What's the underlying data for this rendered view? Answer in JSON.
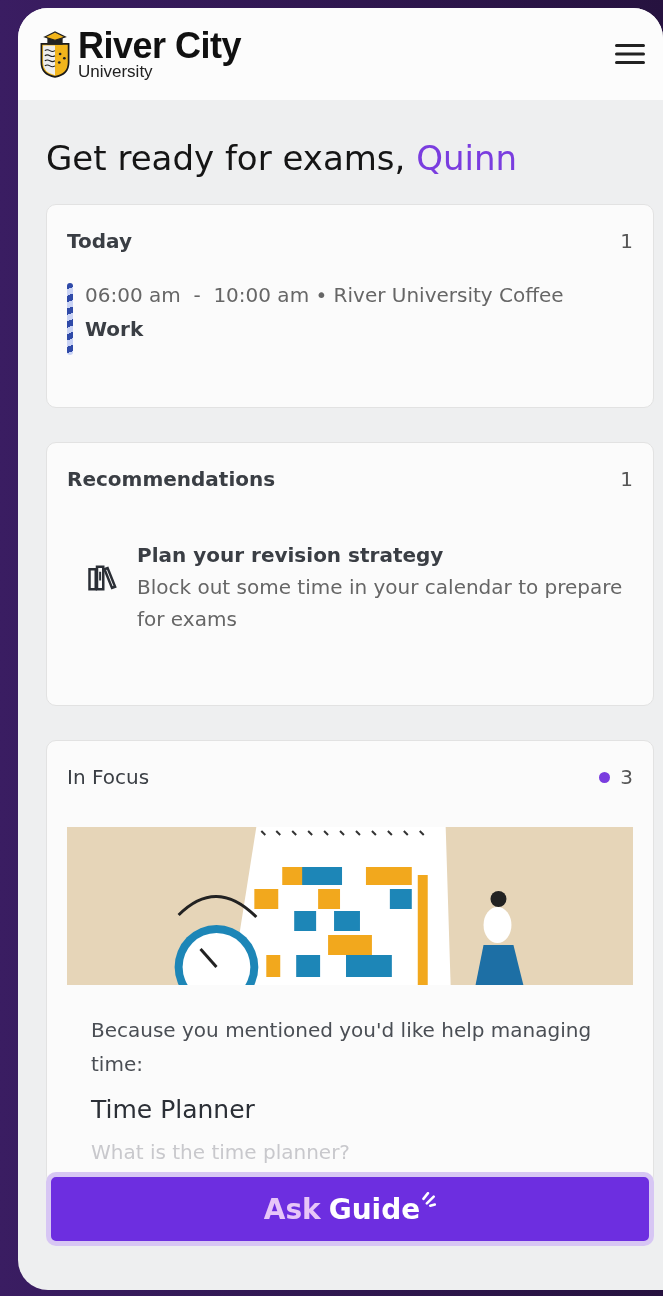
{
  "header": {
    "logo_title": "River City",
    "logo_subtitle": "University"
  },
  "greeting": {
    "text": "Get ready for exams, ",
    "name": "Quinn"
  },
  "cards": [
    {
      "kind": "events",
      "title": "Today",
      "count": "1",
      "dot": false,
      "events": [
        {
          "time": "06:00 am  -  10:00 am • River University Coffee",
          "name": "Work"
        }
      ]
    },
    {
      "kind": "recommendations",
      "title": "Recommendations",
      "count": "1",
      "dot": false,
      "items": [
        {
          "title": "Plan your revision strategy",
          "text": "Block out some time in your calendar to prepare for exams"
        }
      ]
    },
    {
      "kind": "focus",
      "title": "In Focus",
      "count": "3",
      "dot": true,
      "reason": "Because you mentioned you'd like help managing time:",
      "heading": "Time Planner",
      "question": "What is the time planner?"
    }
  ],
  "ask_button": {
    "first": "Ask",
    "second": "Guide"
  }
}
